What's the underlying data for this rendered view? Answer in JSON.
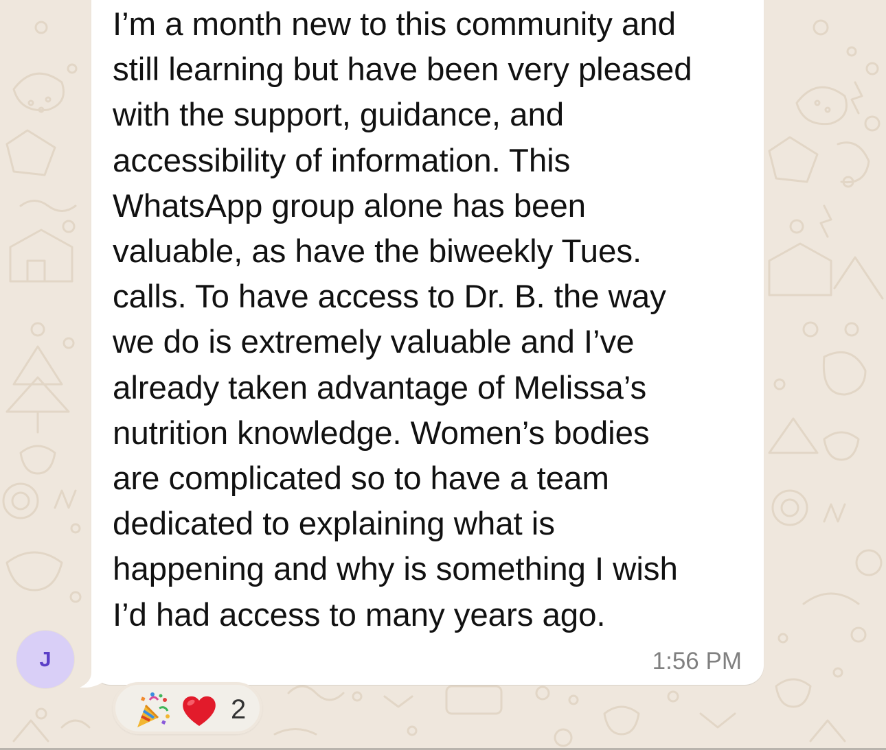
{
  "theme": {
    "wallpaper_color": "#efe7dd",
    "doodle_color": "#e3d8c9",
    "bubble_color": "#ffffff",
    "avatar_bg": "#d9cff7",
    "avatar_fg": "#5b3fc7"
  },
  "message": {
    "text": "I’m a month new to this community and\nstill learning but have been very pleased\nwith the support, guidance, and\naccessibility of information.  This\nWhatsApp group alone has been\nvaluable, as have the biweekly Tues.\ncalls. To have access to Dr. B. the way\nwe do is extremely valuable and I’ve\nalready taken advantage of Melissa’s\nnutrition knowledge.  Women’s bodies\nare complicated so to have a team\ndedicated to explaining what is\nhappening and why is something I wish\nI’d had access to many years ago.",
    "time": "1:56 PM"
  },
  "sender": {
    "avatar_initial": "J"
  },
  "reactions": {
    "emojis": [
      "party-popper-icon",
      "red-heart-icon"
    ],
    "count": "2"
  }
}
